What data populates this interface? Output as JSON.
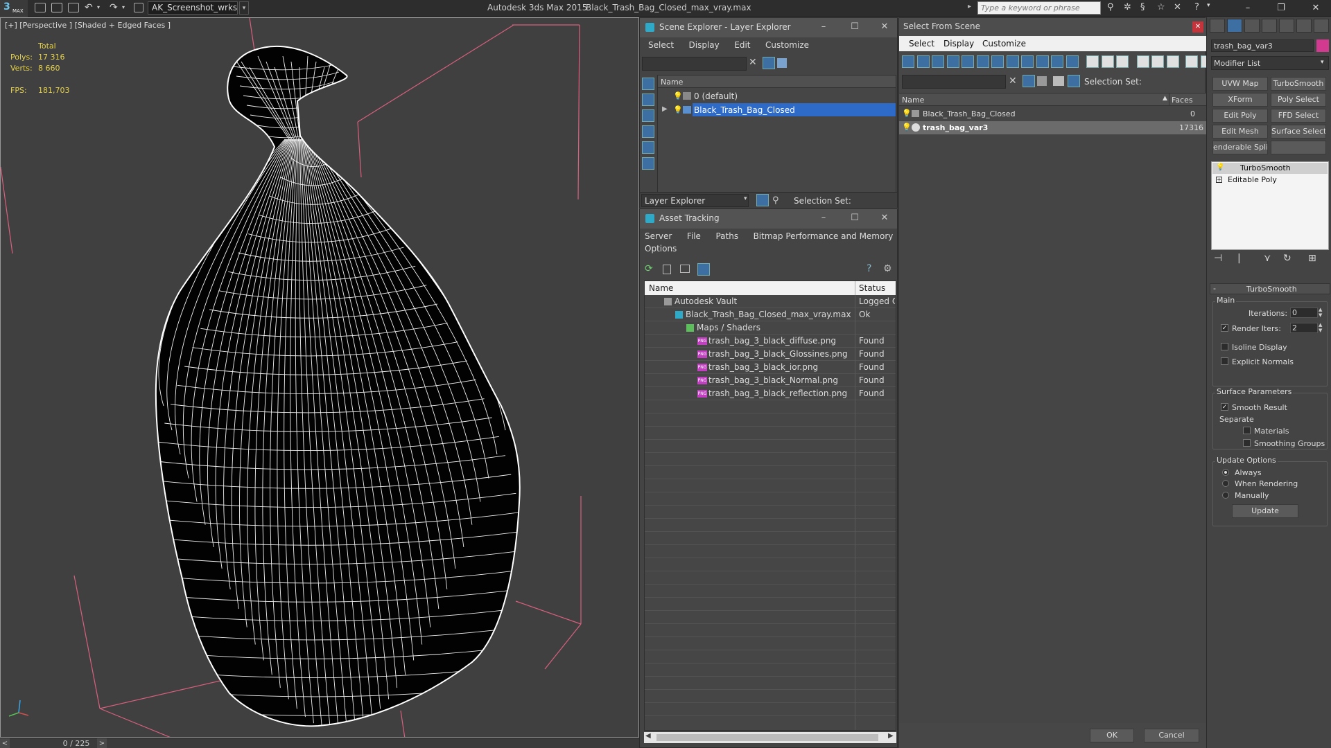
{
  "titlebar": {
    "logo_text": "3",
    "logo_sub": "MAX",
    "workspace": "AK_Screenshot_wrksp",
    "app_title": "Autodesk 3ds Max  2015",
    "doc_title": "Black_Trash_Bag_Closed_max_vray.max",
    "search_placeholder": "Type a keyword or phrase"
  },
  "viewport": {
    "label": "[+] [Perspective ] [Shaded + Edged Faces ]",
    "stats": {
      "total_label": "Total",
      "polys_label": "Polys:",
      "polys_value": "17 316",
      "verts_label": "Verts:",
      "verts_value": "8 660",
      "fps_label": "FPS:",
      "fps_value": "181,703"
    }
  },
  "timebar": {
    "readout": "0 / 225",
    "prev": "<",
    "next": ">"
  },
  "scene_explorer": {
    "title": "Scene Explorer - Layer Explorer",
    "menus": [
      "Select",
      "Display",
      "Edit",
      "Customize"
    ],
    "column_name": "Name",
    "rows": [
      "0 (default)",
      "Black_Trash_Bag_Closed"
    ],
    "footer_dropdown": "Layer Explorer",
    "selection_set_label": "Selection Set:"
  },
  "asset_tracking": {
    "title": "Asset Tracking",
    "menus": [
      "Server",
      "File",
      "Paths",
      "Bitmap Performance and Memory"
    ],
    "menus2": [
      "Options"
    ],
    "col_name": "Name",
    "col_status": "Status",
    "rows": [
      {
        "name": "Autodesk Vault",
        "status": "Logged Ou"
      },
      {
        "name": "Black_Trash_Bag_Closed_max_vray.max",
        "status": "Ok"
      },
      {
        "name": "Maps / Shaders",
        "status": ""
      },
      {
        "name": "trash_bag_3_black_diffuse.png",
        "status": "Found"
      },
      {
        "name": "trash_bag_3_black_Glossines.png",
        "status": "Found"
      },
      {
        "name": "trash_bag_3_black_ior.png",
        "status": "Found"
      },
      {
        "name": "trash_bag_3_black_Normal.png",
        "status": "Found"
      },
      {
        "name": "trash_bag_3_black_reflection.png",
        "status": "Found"
      }
    ],
    "png_badge": "PNG"
  },
  "select_from_scene": {
    "title": "Select From Scene",
    "menus": [
      "Select",
      "Display",
      "Customize"
    ],
    "selection_set_label": "Selection Set:",
    "col_name": "Name",
    "col_faces": "Faces",
    "rows": [
      {
        "name": "Black_Trash_Bag_Closed",
        "faces": "0"
      },
      {
        "name": "trash_bag_var3",
        "faces": "17316"
      }
    ],
    "ok": "OK",
    "cancel": "Cancel"
  },
  "command_panel": {
    "object_name": "trash_bag_var3",
    "modifier_list": "Modifier List",
    "buttons": [
      "UVW Map",
      "TurboSmooth",
      "XForm",
      "Poly Select",
      "Edit Poly",
      "FFD Select",
      "Edit Mesh",
      "Surface Select",
      "enderable Splir",
      ""
    ],
    "stack": [
      "TurboSmooth",
      "Editable Poly"
    ],
    "rollout_title": "TurboSmooth",
    "main_label": "Main",
    "iterations_label": "Iterations:",
    "iterations_value": "0",
    "render_iters_label": "Render Iters:",
    "render_iters_value": "2",
    "isoline_label": "Isoline Display",
    "explicit_normals_label": "Explicit Normals",
    "surface_params_label": "Surface Parameters",
    "smooth_result_label": "Smooth Result",
    "separate_label": "Separate",
    "materials_label": "Materials",
    "smoothing_groups_label": "Smoothing Groups",
    "update_options_label": "Update Options",
    "always_label": "Always",
    "when_rendering_label": "When Rendering",
    "manually_label": "Manually",
    "update_button": "Update",
    "collapse": "-"
  },
  "colors": {
    "selection_blue": "#2e6bc8",
    "stats_yellow": "#e7d24a",
    "wire_white": "#ffffff",
    "box_pink": "#d9607e"
  }
}
